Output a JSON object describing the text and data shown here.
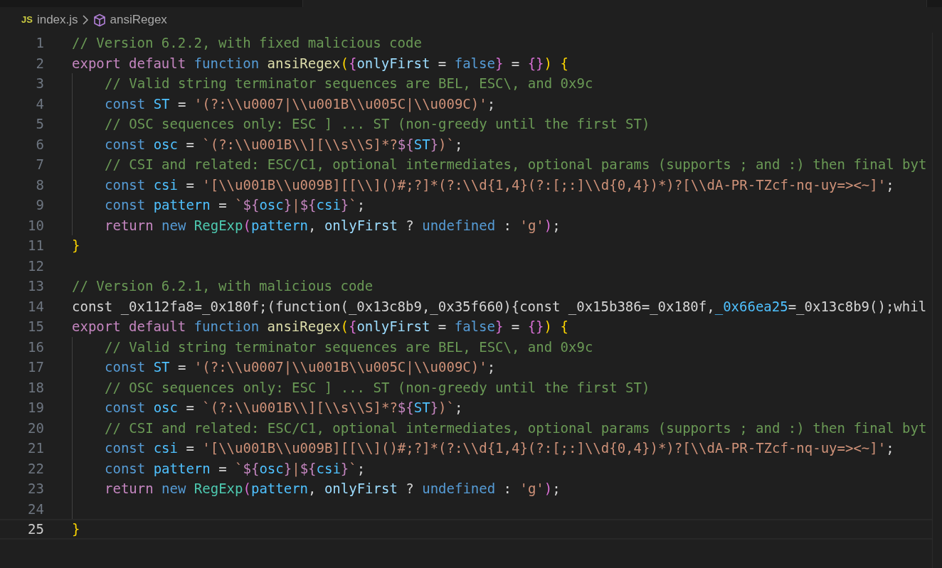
{
  "breadcrumb": {
    "file_badge": "JS",
    "file": "index.js",
    "symbol": "ansiRegex"
  },
  "lines": [
    {
      "number": "1",
      "indented": false,
      "current": false,
      "tokens": [
        {
          "kind": "comment",
          "text": "// Version 6.2.2, with fixed malicious code"
        }
      ]
    },
    {
      "number": "2",
      "indented": false,
      "current": false,
      "tokens": [
        {
          "kind": "keyword",
          "text": "export default "
        },
        {
          "kind": "storage",
          "text": "function "
        },
        {
          "kind": "func",
          "text": "ansiRegex"
        },
        {
          "kind": "bracket1",
          "text": "("
        },
        {
          "kind": "bracket2",
          "text": "{"
        },
        {
          "kind": "variable",
          "text": "onlyFirst"
        },
        {
          "kind": "plain",
          "text": " = "
        },
        {
          "kind": "storage",
          "text": "false"
        },
        {
          "kind": "bracket2",
          "text": "}"
        },
        {
          "kind": "plain",
          "text": " = "
        },
        {
          "kind": "bracket2",
          "text": "{}"
        },
        {
          "kind": "bracket1",
          "text": ") {"
        }
      ]
    },
    {
      "number": "3",
      "indented": true,
      "current": false,
      "tokens": [
        {
          "kind": "comment",
          "text": "// Valid string terminator sequences are BEL, ESC\\, and 0x9c"
        }
      ]
    },
    {
      "number": "4",
      "indented": true,
      "current": false,
      "tokens": [
        {
          "kind": "storage",
          "text": "const "
        },
        {
          "kind": "constant",
          "text": "ST"
        },
        {
          "kind": "plain",
          "text": " = "
        },
        {
          "kind": "string",
          "text": "'(?:\\\\u0007|\\\\u001B\\\\u005C|\\\\u009C)'"
        },
        {
          "kind": "plain",
          "text": ";"
        }
      ]
    },
    {
      "number": "5",
      "indented": true,
      "current": false,
      "tokens": [
        {
          "kind": "comment",
          "text": "// OSC sequences only: ESC ] ... ST (non-greedy until the first ST)"
        }
      ]
    },
    {
      "number": "6",
      "indented": true,
      "current": false,
      "tokens": [
        {
          "kind": "storage",
          "text": "const "
        },
        {
          "kind": "constant",
          "text": "osc"
        },
        {
          "kind": "plain",
          "text": " = "
        },
        {
          "kind": "string",
          "text": "`(?:\\\\u001B\\\\][\\\\s\\\\S]*?"
        },
        {
          "kind": "template",
          "text": "${"
        },
        {
          "kind": "constant",
          "text": "ST"
        },
        {
          "kind": "template",
          "text": "}"
        },
        {
          "kind": "string",
          "text": ")`"
        },
        {
          "kind": "plain",
          "text": ";"
        }
      ]
    },
    {
      "number": "7",
      "indented": true,
      "current": false,
      "tokens": [
        {
          "kind": "comment",
          "text": "// CSI and related: ESC/C1, optional intermediates, optional params (supports ; and :) then final byt"
        }
      ]
    },
    {
      "number": "8",
      "indented": true,
      "current": false,
      "tokens": [
        {
          "kind": "storage",
          "text": "const "
        },
        {
          "kind": "constant",
          "text": "csi"
        },
        {
          "kind": "plain",
          "text": " = "
        },
        {
          "kind": "string",
          "text": "'[\\\\u001B\\\\u009B][[\\\\]()#;?]*(?:\\\\d{1,4}(?:[;:]\\\\d{0,4})*)?[\\\\dA-PR-TZcf-nq-uy=><~]'"
        },
        {
          "kind": "plain",
          "text": ";"
        }
      ]
    },
    {
      "number": "9",
      "indented": true,
      "current": false,
      "tokens": [
        {
          "kind": "storage",
          "text": "const "
        },
        {
          "kind": "constant",
          "text": "pattern"
        },
        {
          "kind": "plain",
          "text": " = "
        },
        {
          "kind": "string",
          "text": "`"
        },
        {
          "kind": "template",
          "text": "${"
        },
        {
          "kind": "constant",
          "text": "osc"
        },
        {
          "kind": "template",
          "text": "}"
        },
        {
          "kind": "string",
          "text": "|"
        },
        {
          "kind": "template",
          "text": "${"
        },
        {
          "kind": "constant",
          "text": "csi"
        },
        {
          "kind": "template",
          "text": "}"
        },
        {
          "kind": "string",
          "text": "`"
        },
        {
          "kind": "plain",
          "text": ";"
        }
      ]
    },
    {
      "number": "10",
      "indented": true,
      "current": false,
      "tokens": [
        {
          "kind": "keyword",
          "text": "return "
        },
        {
          "kind": "storage",
          "text": "new "
        },
        {
          "kind": "class",
          "text": "RegExp"
        },
        {
          "kind": "bracket2",
          "text": "("
        },
        {
          "kind": "constant",
          "text": "pattern"
        },
        {
          "kind": "plain",
          "text": ", "
        },
        {
          "kind": "variable",
          "text": "onlyFirst"
        },
        {
          "kind": "plain",
          "text": " ? "
        },
        {
          "kind": "storage",
          "text": "undefined"
        },
        {
          "kind": "plain",
          "text": " : "
        },
        {
          "kind": "string",
          "text": "'g'"
        },
        {
          "kind": "bracket2",
          "text": ")"
        },
        {
          "kind": "plain",
          "text": ";"
        }
      ]
    },
    {
      "number": "11",
      "indented": false,
      "current": false,
      "tokens": [
        {
          "kind": "bracket1",
          "text": "}"
        }
      ]
    },
    {
      "number": "12",
      "indented": false,
      "current": false
    },
    {
      "number": "13",
      "indented": false,
      "current": false,
      "tokens": [
        {
          "kind": "comment",
          "text": "// Version 6.2.1, with malicious code"
        }
      ]
    },
    {
      "number": "14",
      "indented": false,
      "current": false,
      "tokens": [
        {
          "kind": "plain",
          "text": "const _0x112fa8=_0x180f;(function(_0x13c8b9,_0x35f660){const _0x15b386=_0x180f,"
        },
        {
          "kind": "constant",
          "text": "_0x66ea25"
        },
        {
          "kind": "plain",
          "text": "=_0x13c8b9();whil"
        }
      ]
    },
    {
      "number": "15",
      "indented": false,
      "current": false,
      "tokens": [
        {
          "kind": "keyword",
          "text": "export default "
        },
        {
          "kind": "storage",
          "text": "function "
        },
        {
          "kind": "func",
          "text": "ansiRegex"
        },
        {
          "kind": "bracket1",
          "text": "("
        },
        {
          "kind": "bracket2",
          "text": "{"
        },
        {
          "kind": "variable",
          "text": "onlyFirst"
        },
        {
          "kind": "plain",
          "text": " = "
        },
        {
          "kind": "storage",
          "text": "false"
        },
        {
          "kind": "bracket2",
          "text": "}"
        },
        {
          "kind": "plain",
          "text": " = "
        },
        {
          "kind": "bracket2",
          "text": "{}"
        },
        {
          "kind": "bracket1",
          "text": ") {"
        }
      ]
    },
    {
      "number": "16",
      "indented": true,
      "current": false,
      "tokens": [
        {
          "kind": "comment",
          "text": "// Valid string terminator sequences are BEL, ESC\\, and 0x9c"
        }
      ]
    },
    {
      "number": "17",
      "indented": true,
      "current": false,
      "tokens": [
        {
          "kind": "storage",
          "text": "const "
        },
        {
          "kind": "constant",
          "text": "ST"
        },
        {
          "kind": "plain",
          "text": " = "
        },
        {
          "kind": "string",
          "text": "'(?:\\\\u0007|\\\\u001B\\\\u005C|\\\\u009C)'"
        },
        {
          "kind": "plain",
          "text": ";"
        }
      ]
    },
    {
      "number": "18",
      "indented": true,
      "current": false,
      "tokens": [
        {
          "kind": "comment",
          "text": "// OSC sequences only: ESC ] ... ST (non-greedy until the first ST)"
        }
      ]
    },
    {
      "number": "19",
      "indented": true,
      "current": false,
      "tokens": [
        {
          "kind": "storage",
          "text": "const "
        },
        {
          "kind": "constant",
          "text": "osc"
        },
        {
          "kind": "plain",
          "text": " = "
        },
        {
          "kind": "string",
          "text": "`(?:\\\\u001B\\\\][\\\\s\\\\S]*?"
        },
        {
          "kind": "template",
          "text": "${"
        },
        {
          "kind": "constant",
          "text": "ST"
        },
        {
          "kind": "template",
          "text": "}"
        },
        {
          "kind": "string",
          "text": ")`"
        },
        {
          "kind": "plain",
          "text": ";"
        }
      ]
    },
    {
      "number": "20",
      "indented": true,
      "current": false,
      "tokens": [
        {
          "kind": "comment",
          "text": "// CSI and related: ESC/C1, optional intermediates, optional params (supports ; and :) then final byt"
        }
      ]
    },
    {
      "number": "21",
      "indented": true,
      "current": false,
      "tokens": [
        {
          "kind": "storage",
          "text": "const "
        },
        {
          "kind": "constant",
          "text": "csi"
        },
        {
          "kind": "plain",
          "text": " = "
        },
        {
          "kind": "string",
          "text": "'[\\\\u001B\\\\u009B][[\\\\]()#;?]*(?:\\\\d{1,4}(?:[;:]\\\\d{0,4})*)?[\\\\dA-PR-TZcf-nq-uy=><~]'"
        },
        {
          "kind": "plain",
          "text": ";"
        }
      ]
    },
    {
      "number": "22",
      "indented": true,
      "current": false,
      "tokens": [
        {
          "kind": "storage",
          "text": "const "
        },
        {
          "kind": "constant",
          "text": "pattern"
        },
        {
          "kind": "plain",
          "text": " = "
        },
        {
          "kind": "string",
          "text": "`"
        },
        {
          "kind": "template",
          "text": "${"
        },
        {
          "kind": "constant",
          "text": "osc"
        },
        {
          "kind": "template",
          "text": "}"
        },
        {
          "kind": "string",
          "text": "|"
        },
        {
          "kind": "template",
          "text": "${"
        },
        {
          "kind": "constant",
          "text": "csi"
        },
        {
          "kind": "template",
          "text": "}"
        },
        {
          "kind": "string",
          "text": "`"
        },
        {
          "kind": "plain",
          "text": ";"
        }
      ]
    },
    {
      "number": "23",
      "indented": true,
      "current": false,
      "tokens": [
        {
          "kind": "keyword",
          "text": "return "
        },
        {
          "kind": "storage",
          "text": "new "
        },
        {
          "kind": "class",
          "text": "RegExp"
        },
        {
          "kind": "bracket2",
          "text": "("
        },
        {
          "kind": "constant",
          "text": "pattern"
        },
        {
          "kind": "plain",
          "text": ", "
        },
        {
          "kind": "variable",
          "text": "onlyFirst"
        },
        {
          "kind": "plain",
          "text": " ? "
        },
        {
          "kind": "storage",
          "text": "undefined"
        },
        {
          "kind": "plain",
          "text": " : "
        },
        {
          "kind": "string",
          "text": "'g'"
        },
        {
          "kind": "bracket2",
          "text": ")"
        },
        {
          "kind": "plain",
          "text": ";"
        }
      ]
    },
    {
      "number": "24",
      "indented": true,
      "current": false
    },
    {
      "number": "25",
      "indented": false,
      "current": true,
      "tokens": [
        {
          "kind": "bracket1",
          "text": "}"
        }
      ]
    }
  ]
}
